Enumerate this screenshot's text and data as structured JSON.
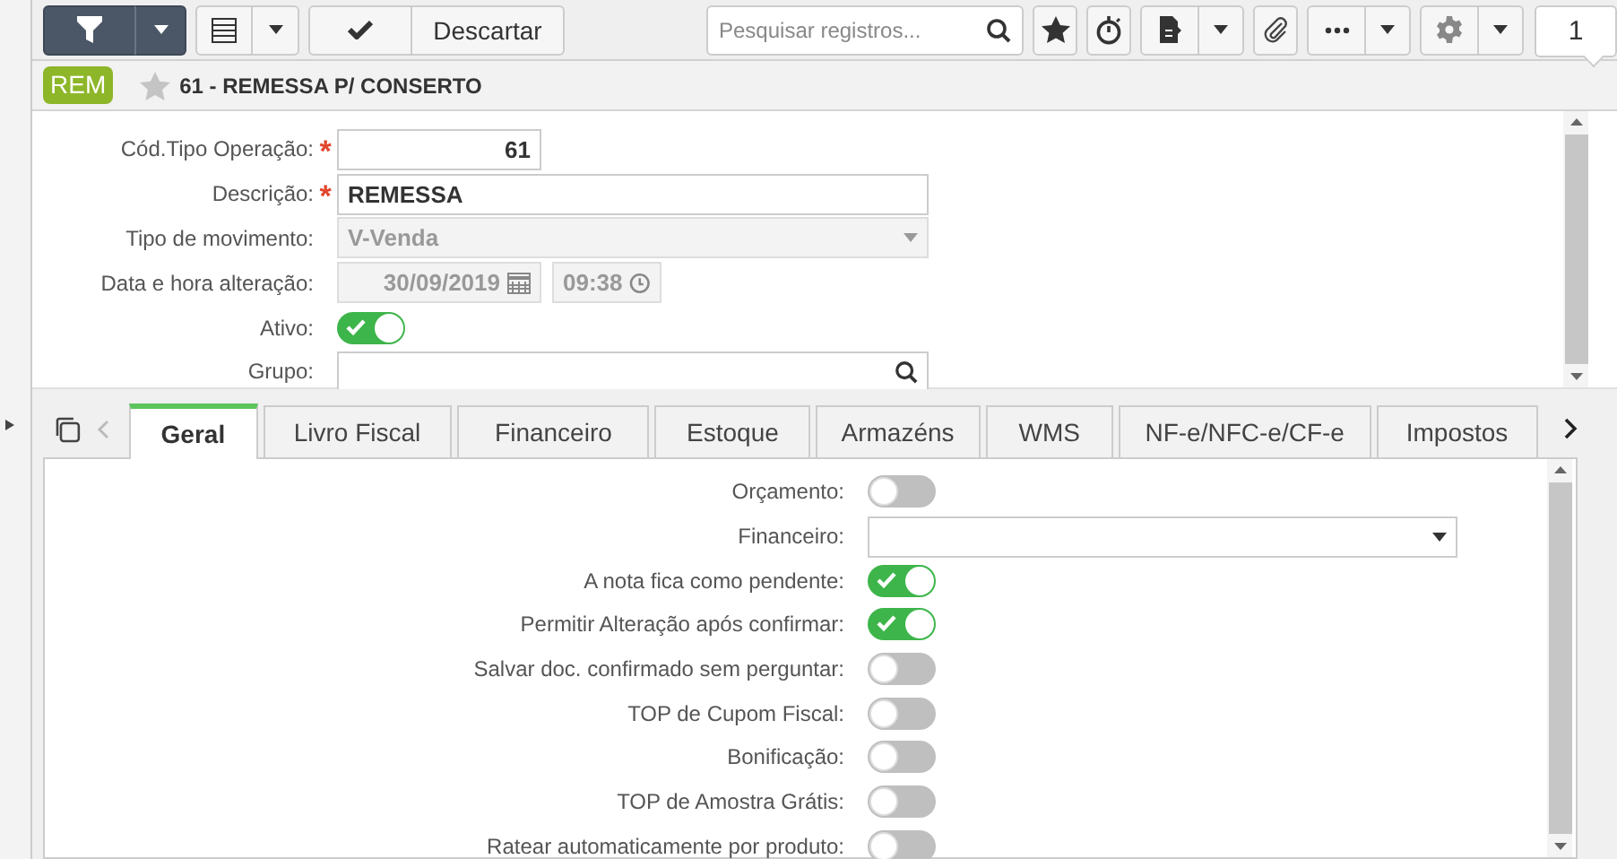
{
  "toolbar": {
    "discard_button": "Descartar",
    "search": {
      "placeholder": "Pesquisar registros..."
    },
    "record_count": "1"
  },
  "header": {
    "badge": "REM",
    "title": "61 - REMESSA P/ CONSERTO",
    "favorite": false
  },
  "form": {
    "fields": [
      {
        "kind": "number",
        "label": "Cód.Tipo Operação:",
        "required_mark": "*",
        "disabled": false,
        "value": "61"
      },
      {
        "kind": "text",
        "label": "Descrição:",
        "required_mark": "*",
        "disabled": false,
        "value": "REMESSA"
      },
      {
        "kind": "select",
        "label": "Tipo de movimento:",
        "disabled": true,
        "value": "V-Venda"
      },
      {
        "kind": "datetime",
        "label": "Data e hora alteração:",
        "disabled": true,
        "date": "30/09/2019",
        "time": "09:38"
      },
      {
        "kind": "toggle",
        "label": "Ativo:",
        "disabled": false,
        "on": true
      },
      {
        "kind": "lookup",
        "label": "Grupo:",
        "disabled": false
      }
    ]
  },
  "tabs": [
    {
      "label": "Geral",
      "selected": true
    },
    {
      "label": "Livro Fiscal",
      "selected": false
    },
    {
      "label": "Financeiro",
      "selected": false
    },
    {
      "label": "Estoque",
      "selected": false
    },
    {
      "label": "Armazéns",
      "selected": false
    },
    {
      "label": "WMS",
      "selected": false
    },
    {
      "label": "NF-e/NFC-e/CF-e",
      "selected": false
    },
    {
      "label": "Impostos",
      "selected": false
    }
  ],
  "panel": {
    "rows": [
      {
        "kind": "toggle",
        "label": "Orçamento:",
        "on": false
      },
      {
        "kind": "select",
        "label": "Financeiro:"
      },
      {
        "kind": "toggle",
        "label": "A nota fica como pendente:",
        "on": true
      },
      {
        "kind": "toggle",
        "label": "Permitir Alteração após confirmar:",
        "on": true
      },
      {
        "kind": "toggle",
        "label": "Salvar doc. confirmado sem perguntar:",
        "on": false
      },
      {
        "kind": "toggle",
        "label": "TOP de Cupom Fiscal:",
        "on": false
      },
      {
        "kind": "toggle",
        "label": "Bonificação:",
        "on": false
      },
      {
        "kind": "toggle",
        "label": "TOP de Amostra Grátis:",
        "on": false
      },
      {
        "kind": "toggle",
        "label": "Ratear automaticamente por produto:",
        "on": false
      }
    ]
  }
}
